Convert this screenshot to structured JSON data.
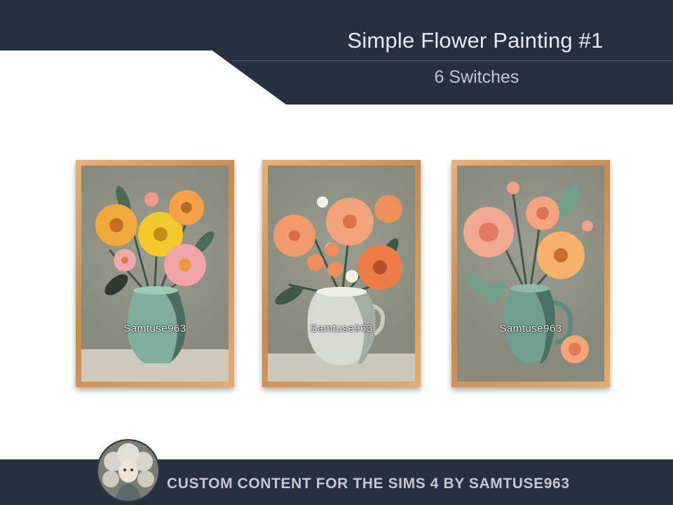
{
  "header": {
    "title": "Simple Flower Painting #1",
    "subtitle": "6 Switches"
  },
  "paintings": [
    {
      "watermark": "Samtuse963",
      "theme": "yellow-orange-pink daisies in teal vase"
    },
    {
      "watermark": "Samtuse963",
      "theme": "orange gerberas and white daisies in white vase"
    },
    {
      "watermark": "Samtuse963",
      "theme": "peach peonies in teal jug"
    }
  ],
  "footer": {
    "text": "CUSTOM CONTENT FOR THE SIMS 4 BY SAMTUSE963"
  },
  "colors": {
    "dark_band": "#263140",
    "frame_wood": "#d99a5c",
    "canvas_grey": "#8b8f83"
  }
}
